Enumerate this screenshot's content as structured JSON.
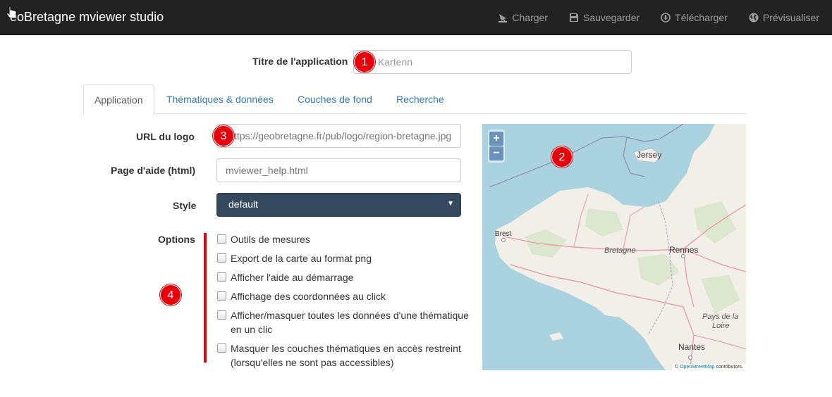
{
  "navbar": {
    "brand": "éoBretagne mviewer studio",
    "items": [
      {
        "label": "Charger",
        "icon": "upload-icon"
      },
      {
        "label": "Sauvegarder",
        "icon": "floppy-icon"
      },
      {
        "label": "Télécharger",
        "icon": "download-icon"
      },
      {
        "label": "Prévisualiser",
        "icon": "globe-icon"
      }
    ]
  },
  "title_field": {
    "label": "Titre de l'application",
    "placeholder": "Kartenn"
  },
  "tabs": [
    {
      "label": "Application",
      "active": true
    },
    {
      "label": "Thématiques & données",
      "active": false
    },
    {
      "label": "Couches de fond",
      "active": false
    },
    {
      "label": "Recherche",
      "active": false
    }
  ],
  "form": {
    "logo_label": "URL du logo",
    "logo_placeholder": "ttps://geobretagne.fr/pub/logo/region-bretagne.jpg",
    "help_label": "Page d'aide (html)",
    "help_placeholder": "mviewer_help.html",
    "style_label": "Style",
    "style_value": "default",
    "options_label": "Options",
    "options": [
      "Outils de mesures",
      "Export de la carte au format png",
      "Afficher l'aide au démarrage",
      "Affichage des coordonnées au click",
      "Afficher/masquer toutes les données d'une thématique en un clic",
      "Masquer les couches thématiques en accès restreint (lorsqu'elles ne sont pas accessibles)"
    ]
  },
  "badges": [
    "1",
    "2",
    "3",
    "4"
  ],
  "map": {
    "zoom_in": "+",
    "zoom_out": "−",
    "labels": {
      "jersey": "Jersey",
      "brest": "Brest",
      "bretagne": "Bretagne",
      "rennes": "Rennes",
      "pays_de_la_loire_1": "Pays de la",
      "pays_de_la_loire_2": "Loire",
      "nantes": "Nantes"
    },
    "attribution_prefix": "© ",
    "attribution_link": "OpenStreetMap",
    "attribution_suffix": " contributors."
  },
  "colors": {
    "navbar_bg": "#222222",
    "badge": "#e8000b",
    "select_bg": "#34495e",
    "tab_link": "#337ab7",
    "sea": "#aad3df",
    "land": "#f2efe9"
  }
}
